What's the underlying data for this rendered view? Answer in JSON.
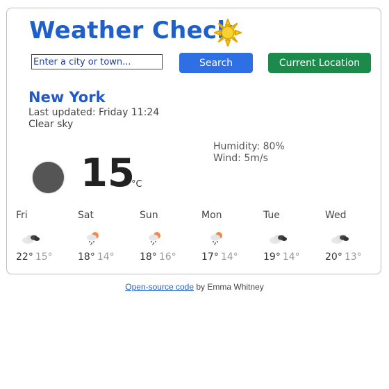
{
  "header": {
    "title": "Weather Check",
    "logo_icon": "sun-icon"
  },
  "search": {
    "placeholder": "Enter a city or town...",
    "value": "",
    "search_label": "Search",
    "location_label": "Current Location"
  },
  "current": {
    "city": "New York",
    "updated": "Last updated: Friday 11:24",
    "description": "Clear sky",
    "icon": "dark-circle-icon",
    "temperature": "15",
    "unit": "°C",
    "humidity": "Humidity: 80%",
    "wind": "Wind: 5m/s"
  },
  "forecast": [
    {
      "day": "Fri",
      "icon": "broken-clouds-icon",
      "max": "22°",
      "min": "15°"
    },
    {
      "day": "Sat",
      "icon": "rain-snow-icon",
      "max": "18°",
      "min": "14°"
    },
    {
      "day": "Sun",
      "icon": "rain-snow-icon",
      "max": "18°",
      "min": "16°"
    },
    {
      "day": "Mon",
      "icon": "rain-snow-icon",
      "max": "17°",
      "min": "14°"
    },
    {
      "day": "Tue",
      "icon": "broken-clouds-icon",
      "max": "19°",
      "min": "14°"
    },
    {
      "day": "Wed",
      "icon": "broken-clouds-icon",
      "max": "20°",
      "min": "13°"
    }
  ],
  "footer": {
    "link_text": "Open-source code",
    "author_text": " by Emma Whitney"
  },
  "colors": {
    "title": "#1f5fc9",
    "search_button": "#2f6fe4",
    "location_button": "#1c8a4a"
  }
}
